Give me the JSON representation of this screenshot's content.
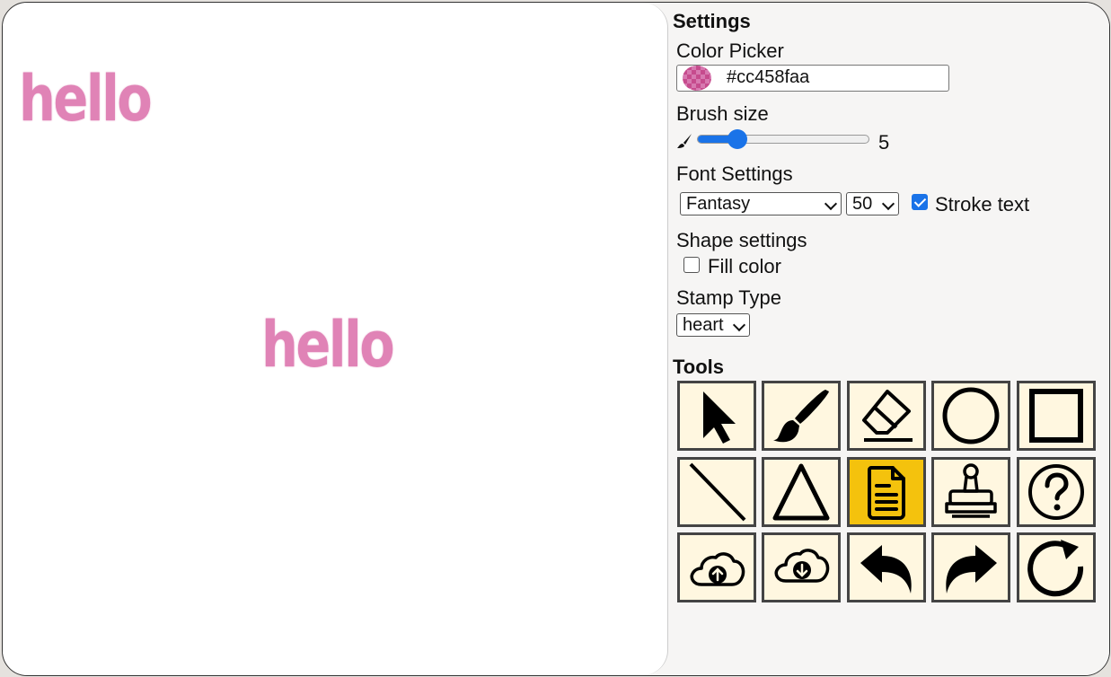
{
  "canvas": {
    "texts": [
      "hello",
      "hello"
    ]
  },
  "settings": {
    "title": "Settings",
    "color_picker": {
      "label": "Color Picker",
      "value": "#cc458faa",
      "color": "#cc458f"
    },
    "brush": {
      "label": "Brush size",
      "value": "5",
      "fraction": 0.2
    },
    "font": {
      "label": "Font Settings",
      "family": "Fantasy",
      "size": "50",
      "stroke_label": "Stroke text",
      "stroke_checked": true
    },
    "shape": {
      "label": "Shape settings",
      "fill_label": "Fill color",
      "fill_checked": false
    },
    "stamp": {
      "label": "Stamp Type",
      "value": "heart"
    }
  },
  "tools": {
    "title": "Tools",
    "items": [
      {
        "icon": "pointer-icon",
        "active": false
      },
      {
        "icon": "brush-icon",
        "active": false
      },
      {
        "icon": "eraser-icon",
        "active": false
      },
      {
        "icon": "circle-icon",
        "active": false
      },
      {
        "icon": "square-icon",
        "active": false
      },
      {
        "icon": "line-icon",
        "active": false
      },
      {
        "icon": "triangle-icon",
        "active": false
      },
      {
        "icon": "text-document-icon",
        "active": true
      },
      {
        "icon": "stamp-icon",
        "active": false
      },
      {
        "icon": "help-icon",
        "active": false
      },
      {
        "icon": "cloud-upload-icon",
        "active": false
      },
      {
        "icon": "cloud-download-icon",
        "active": false
      },
      {
        "icon": "undo-icon",
        "active": false
      },
      {
        "icon": "redo-icon",
        "active": false
      },
      {
        "icon": "reset-icon",
        "active": false
      }
    ]
  }
}
